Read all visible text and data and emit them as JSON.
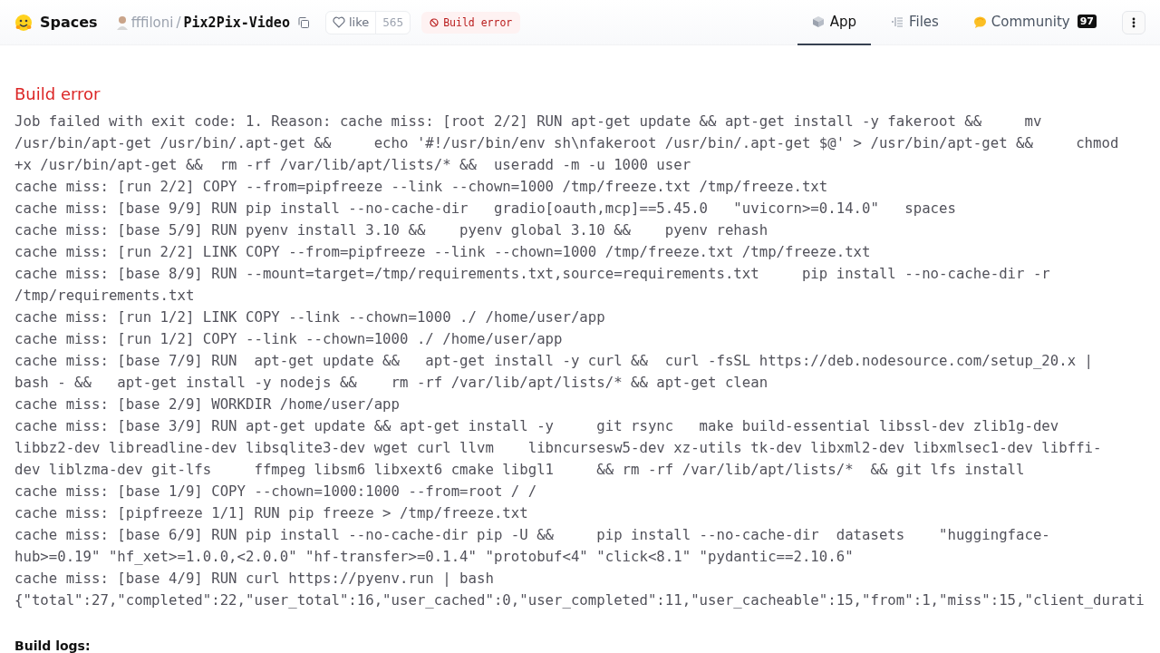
{
  "header": {
    "brand": "Spaces",
    "owner": "fffiloni",
    "separator": "/",
    "repo": "Pix2Pix-Video",
    "like": {
      "label": "like",
      "count": "565"
    },
    "status_badge": "Build error",
    "tabs": [
      {
        "label": "App",
        "kind": "app",
        "selected": true
      },
      {
        "label": "Files",
        "kind": "files",
        "selected": false
      },
      {
        "label": "Community",
        "kind": "community",
        "badge": "97",
        "selected": false
      }
    ]
  },
  "error": {
    "title": "Build error",
    "lines": [
      "Job failed with exit code: 1. Reason: cache miss: [root 2/2] RUN apt-get update && apt-get install -y fakeroot &&     mv",
      "/usr/bin/apt-get /usr/bin/.apt-get &&     echo '#!/usr/bin/env sh\\nfakeroot /usr/bin/.apt-get $@' > /usr/bin/apt-get &&     chmod",
      "+x /usr/bin/apt-get &&  rm -rf /var/lib/apt/lists/* &&  useradd -m -u 1000 user",
      "cache miss: [run 2/2] COPY --from=pipfreeze --link --chown=1000 /tmp/freeze.txt /tmp/freeze.txt",
      "cache miss: [base 9/9] RUN pip install --no-cache-dir   gradio[oauth,mcp]==5.45.0   \"uvicorn>=0.14.0\"   spaces",
      "cache miss: [base 5/9] RUN pyenv install 3.10 &&    pyenv global 3.10 &&    pyenv rehash",
      "cache miss: [run 2/2] LINK COPY --from=pipfreeze --link --chown=1000 /tmp/freeze.txt /tmp/freeze.txt",
      "cache miss: [base 8/9] RUN --mount=target=/tmp/requirements.txt,source=requirements.txt     pip install --no-cache-dir -r",
      "/tmp/requirements.txt",
      "cache miss: [run 1/2] LINK COPY --link --chown=1000 ./ /home/user/app",
      "cache miss: [run 1/2] COPY --link --chown=1000 ./ /home/user/app",
      "cache miss: [base 7/9] RUN  apt-get update &&   apt-get install -y curl &&  curl -fsSL https://deb.nodesource.com/setup_20.x |",
      "bash - &&   apt-get install -y nodejs &&    rm -rf /var/lib/apt/lists/* && apt-get clean",
      "cache miss: [base 2/9] WORKDIR /home/user/app",
      "cache miss: [base 3/9] RUN apt-get update && apt-get install -y     git rsync   make build-essential libssl-dev zlib1g-dev",
      "libbz2-dev libreadline-dev libsqlite3-dev wget curl llvm    libncursesw5-dev xz-utils tk-dev libxml2-dev libxmlsec1-dev libffi-",
      "dev liblzma-dev git-lfs     ffmpeg libsm6 libxext6 cmake libgl1     && rm -rf /var/lib/apt/lists/*  && git lfs install",
      "cache miss: [base 1/9] COPY --chown=1000:1000 --from=root / /",
      "cache miss: [pipfreeze 1/1] RUN pip freeze > /tmp/freeze.txt",
      "cache miss: [base 6/9] RUN pip install --no-cache-dir pip -U &&     pip install --no-cache-dir  datasets    \"huggingface-",
      "hub>=0.19\" \"hf_xet>=1.0.0,<2.0.0\" \"hf-transfer>=0.1.4\" \"protobuf<4\" \"click<8.1\" \"pydantic==2.10.6\"",
      "cache miss: [base 4/9] RUN curl https://pyenv.run | bash",
      "{\"total\":27,\"completed\":22,\"user_total\":16,\"user_cached\":0,\"user_completed\":11,\"user_cacheable\":15,\"from\":1,\"miss\":15,\"client_durati"
    ]
  },
  "logs_heading": "Build logs:"
}
